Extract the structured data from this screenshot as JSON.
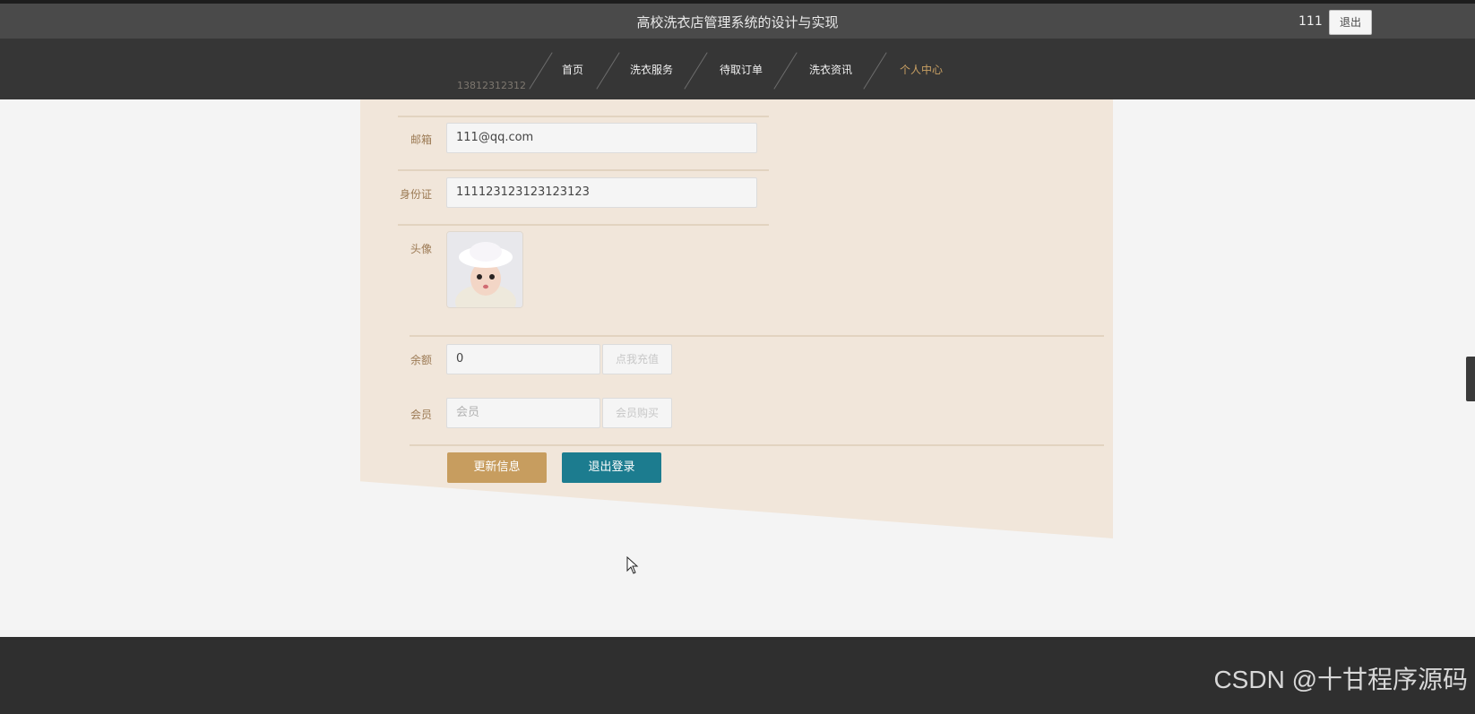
{
  "header": {
    "title": "高校洗衣店管理系统的设计与实现",
    "user": "111",
    "logout_label": "退出"
  },
  "nav": {
    "items": [
      {
        "label": "首页"
      },
      {
        "label": "洗衣服务"
      },
      {
        "label": "待取订单"
      },
      {
        "label": "洗衣资讯"
      },
      {
        "label": "个人中心",
        "active": true
      }
    ]
  },
  "form": {
    "phone_value": "13812312312",
    "email": {
      "label": "邮箱",
      "value": "111@qq.com"
    },
    "id_card": {
      "label": "身份证",
      "value": "111123123123123123"
    },
    "avatar": {
      "label": "头像"
    },
    "balance": {
      "label": "余额",
      "value": "0",
      "button": "点我充值"
    },
    "member": {
      "label": "会员",
      "placeholder": "会员",
      "button": "会员购买"
    },
    "update_label": "更新信息",
    "logout_label": "退出登录"
  },
  "watermark": "CSDN @十甘程序源码",
  "colors": {
    "topbar": "#4a4a4a",
    "navbar": "#363636",
    "panel": "#f1e6da",
    "accent_gold": "#c79d5f",
    "accent_teal": "#1c7c8f"
  }
}
